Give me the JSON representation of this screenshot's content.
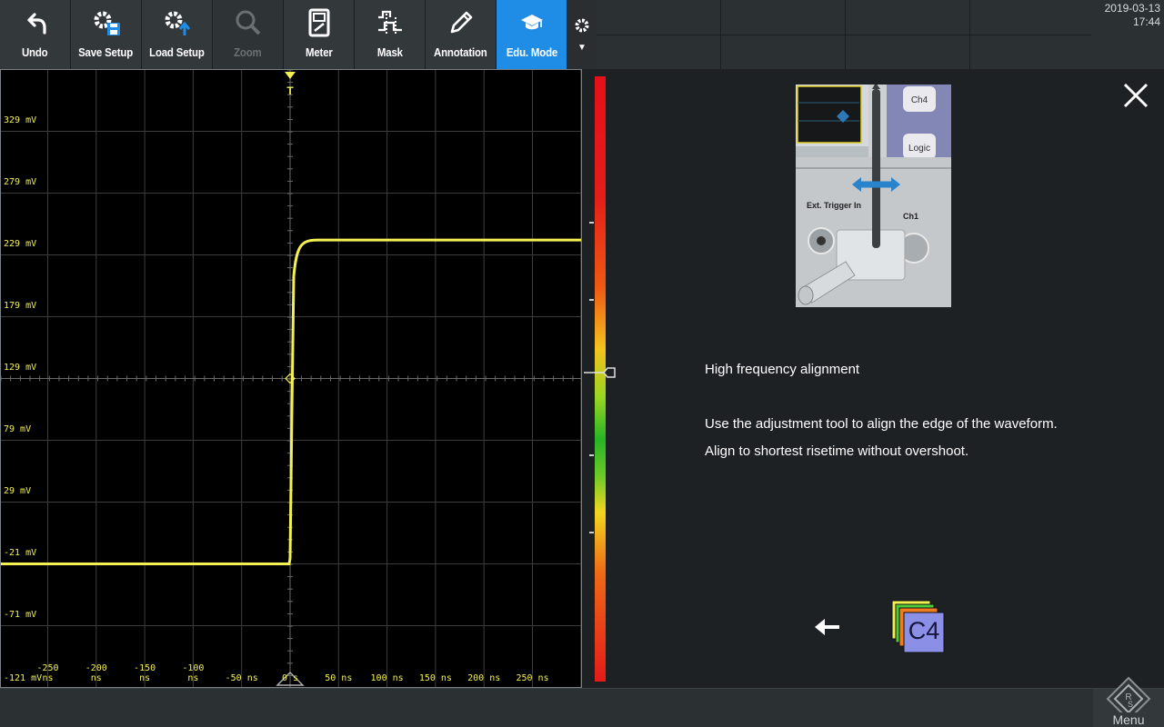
{
  "toolbar": {
    "buttons": [
      {
        "label": "Undo",
        "icon": "undo-icon",
        "state": "normal"
      },
      {
        "label": "Save Setup",
        "icon": "save-setup-icon",
        "state": "normal"
      },
      {
        "label": "Load Setup",
        "icon": "load-setup-icon",
        "state": "normal"
      },
      {
        "label": "Zoom",
        "icon": "zoom-icon",
        "state": "disabled"
      },
      {
        "label": "Meter",
        "icon": "meter-icon",
        "state": "normal"
      },
      {
        "label": "Mask",
        "icon": "mask-icon",
        "state": "normal"
      },
      {
        "label": "Annotation",
        "icon": "annotation-icon",
        "state": "normal"
      },
      {
        "label": "Edu. Mode",
        "icon": "edu-mode-icon",
        "state": "active"
      }
    ],
    "settings_icon": "gear-icon"
  },
  "clock": {
    "date": "2019-03-13",
    "time": "17:44"
  },
  "scope": {
    "trigger_marker": "T",
    "y_labels": [
      "329 mV",
      "279 mV",
      "229 mV",
      "179 mV",
      "129 mV",
      "79 mV",
      "29 mV",
      "-21 mV",
      "-71 mV",
      "-121 mV"
    ],
    "x_labels": [
      "-250 ns",
      "-200 ns",
      "-150 ns",
      "-100 ns",
      "-50 ns",
      "0 s",
      "50 ns",
      "100 ns",
      "150 ns",
      "200 ns",
      "250 ns"
    ],
    "trace_color": "#f4f052",
    "waveform": {
      "low_mv": -21,
      "high_mv": 241,
      "edge_ns": 0
    }
  },
  "edu": {
    "title": "High frequency alignment",
    "line1": "Use the adjustment tool to align the edge of the waveform.",
    "line2": "Align to shortest risetime without overshoot.",
    "image_labels": {
      "ch4": "Ch4",
      "logic": "Logic",
      "ext_trigger": "Ext. Trigger In",
      "ch1": "Ch1"
    },
    "channel_button": "C4"
  },
  "menu": {
    "label": "Menu"
  }
}
